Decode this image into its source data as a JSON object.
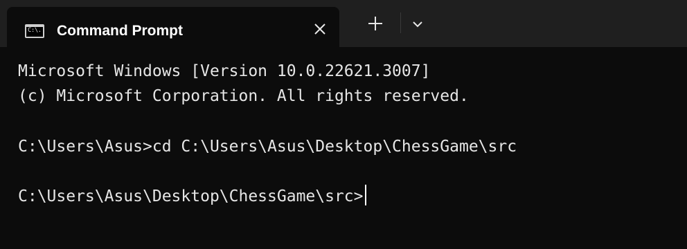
{
  "tab": {
    "title": "Command Prompt",
    "icon": "cmd-icon",
    "icon_glyph": "C:\\.",
    "close_icon": "close-icon"
  },
  "toolbar": {
    "new_tab_icon": "plus-icon",
    "dropdown_icon": "chevron-down-icon"
  },
  "terminal": {
    "lines": [
      "Microsoft Windows [Version 10.0.22621.3007]",
      "(c) Microsoft Corporation. All rights reserved.",
      "",
      "C:\\Users\\Asus>cd C:\\Users\\Asus\\Desktop\\ChessGame\\src",
      "",
      "C:\\Users\\Asus\\Desktop\\ChessGame\\src>"
    ]
  },
  "colors": {
    "background": "#0c0c0c",
    "tabbar": "#1f1f1f",
    "text": "#e6e6e6"
  }
}
